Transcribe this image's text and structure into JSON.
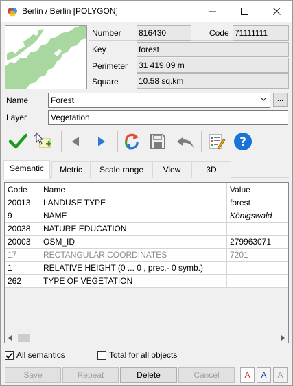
{
  "window": {
    "title": "Berlin / Berlin [POLYGON]"
  },
  "info": {
    "number_label": "Number",
    "number_value": "816430",
    "code_label": "Code",
    "code_value": "71111111",
    "key_label": "Key",
    "key_value": "forest",
    "perimeter_label": "Perimeter",
    "perimeter_value": "31 419.09 m",
    "square_label": "Square",
    "square_value": "10.58 sq.km"
  },
  "name_field": {
    "label": "Name",
    "value": "Forest",
    "ellipsis": "..."
  },
  "layer_field": {
    "label": "Layer",
    "value": "Vegetation"
  },
  "toolbar": [
    "apply-check-icon",
    "select-object-icon",
    "previous-icon",
    "next-icon",
    "refresh-icon",
    "save-disk-icon",
    "undo-icon",
    "edit-form-icon",
    "help-icon"
  ],
  "tabs": [
    "Semantic",
    "Metric",
    "Scale range",
    "View",
    "3D"
  ],
  "table": {
    "headers": [
      "Code",
      "Name",
      "Value"
    ],
    "rows": [
      {
        "code": "20013",
        "name": "LANDUSE TYPE",
        "value": "forest"
      },
      {
        "code": "9",
        "name": "NAME",
        "value": "Königswald"
      },
      {
        "code": "20038",
        "name": "NATURE EDUCATION",
        "value": ""
      },
      {
        "code": "20003",
        "name": "OSM_ID",
        "value": "279963071"
      },
      {
        "code": "17",
        "name": "RECTANGULAR COORDINATES",
        "value": "7201"
      },
      {
        "code": "1",
        "name": "RELATIVE HEIGHT  (0 ... 0 , prec.- 0  symb.)",
        "value": ""
      },
      {
        "code": "262",
        "name": "TYPE OF VEGETATION",
        "value": ""
      }
    ]
  },
  "options": {
    "all_semantics": "All semantics",
    "total_for_all": "Total for all objects"
  },
  "buttons": {
    "save": "Save",
    "repeat": "Repeat",
    "delete": "Delete",
    "cancel": "Cancel",
    "font_a": "A"
  },
  "colors": {
    "forest": "#a8d8a0",
    "check": "#1f9a1f",
    "help": "#1a73d8"
  }
}
